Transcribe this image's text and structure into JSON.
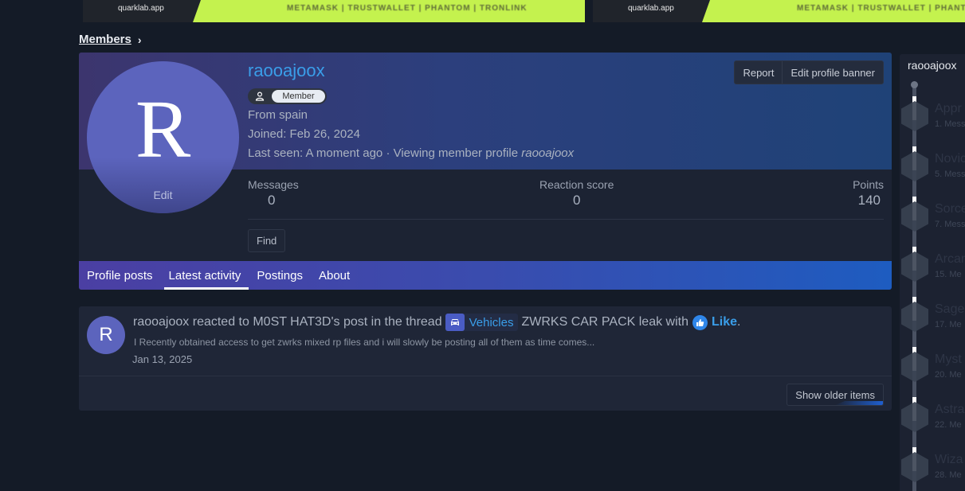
{
  "banners": [
    {
      "domain": "quarklab.app",
      "wallets": "METAMASK | TRUSTWALLET | PHANTOM | TRONLINK"
    },
    {
      "domain": "quarklab.app",
      "wallets": "METAMASK | TRUSTWALLET | PHANTOM | T"
    }
  ],
  "breadcrumb": {
    "label": "Members",
    "separator": "›"
  },
  "profile": {
    "username": "raooajoox",
    "avatar_letter": "R",
    "avatar_edit": "Edit",
    "role": "Member",
    "role_icon": "user-icon",
    "from": "From spain",
    "joined": "Joined: Feb 26, 2024",
    "last_seen_prefix": "Last seen: A moment ago · Viewing member profile ",
    "last_seen_target": "raooajoox",
    "actions": {
      "report": "Report",
      "edit_banner": "Edit profile banner"
    },
    "stats": {
      "messages_label": "Messages",
      "messages_value": "0",
      "reaction_label": "Reaction score",
      "reaction_value": "0",
      "points_label": "Points",
      "points_value": "140"
    },
    "find_label": "Find"
  },
  "tabs": [
    {
      "label": "Profile posts",
      "active": false
    },
    {
      "label": "Latest activity",
      "active": true
    },
    {
      "label": "Postings",
      "active": false
    },
    {
      "label": "About",
      "active": false
    }
  ],
  "activity": {
    "avatar_letter": "R",
    "user": "raooajoox",
    "text_reacted": "reacted to",
    "target_user": "M0ST HAT3D's",
    "text_post": "post in the thread",
    "prefix_icon": "car-icon",
    "prefix_label": "Vehicles",
    "thread": "ZWRKS CAR PACK leak",
    "text_with": "with",
    "reaction_icon": "thumbs-up-icon",
    "reaction": "Like",
    "period": ".",
    "snippet": "I Recently obtained access to get zwrks mixed rp files and i will slowly be posting all of them as time comes...",
    "date": "Jan 13, 2025",
    "older_label": "Show older items"
  },
  "sidebar": {
    "username": "raooajoox",
    "ranks": [
      {
        "title": "Appr",
        "sub": "1. Mess"
      },
      {
        "title": "Novic",
        "sub": "5. Mess"
      },
      {
        "title": "Sorce",
        "sub": "7. Mess"
      },
      {
        "title": "Arcan",
        "sub": "15. Me"
      },
      {
        "title": "Sage",
        "sub": "17. Me"
      },
      {
        "title": "Myst",
        "sub": "20. Me"
      },
      {
        "title": "Astra",
        "sub": "22. Me"
      },
      {
        "title": "Wiza",
        "sub": "28. Me"
      }
    ]
  },
  "colors": {
    "background": "#141b27",
    "accent_link": "#3a9ee9",
    "avatar": "#5c64bd",
    "banner_lime": "#c4f24e",
    "tab_gradient_start": "#4b3fa3",
    "tab_gradient_end": "#1e5cc0"
  }
}
